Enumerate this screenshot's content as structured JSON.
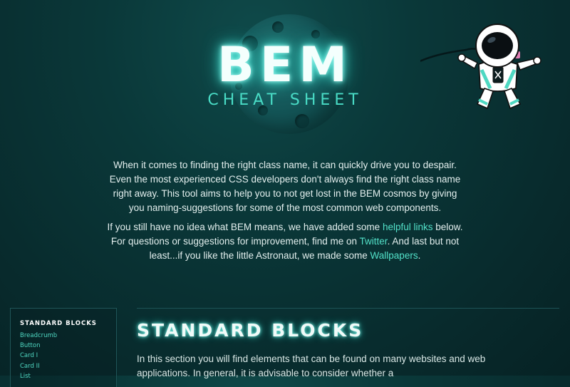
{
  "logo": {
    "title": "BEM",
    "subtitle": "CHEAT SHEET"
  },
  "intro": {
    "paragraph1": "When it comes to finding the right class name, it can quickly drive you to despair. Even the most experienced CSS developers don't always find the right class name right away. This tool aims to help you to not get lost in the BEM cosmos by giving you naming-suggestions for some of the most common web components.",
    "p2_text1": "If you still have no idea what BEM means, we have added some ",
    "p2_link1": "helpful links",
    "p2_text2": " below. For questions or suggestions for improvement, find me on ",
    "p2_link2": "Twitter",
    "p2_text3": ". And last but not least...if you like the little Astronaut, we made some ",
    "p2_link3": "Wallpapers",
    "p2_text4": "."
  },
  "sidebar": {
    "title": "STANDARD BLOCKS",
    "items": [
      {
        "label": "Breadcrumb"
      },
      {
        "label": "Button"
      },
      {
        "label": "Card I"
      },
      {
        "label": "Card II"
      },
      {
        "label": "List"
      }
    ]
  },
  "section": {
    "title": "STANDARD BLOCKS",
    "intro": "In this section you will find elements that can be found on many websites and web applications. In general, it is advisable to consider whether a"
  },
  "colors": {
    "background": "#0a3839",
    "accent": "#4fd8c2",
    "glow": "#52e7d8"
  }
}
